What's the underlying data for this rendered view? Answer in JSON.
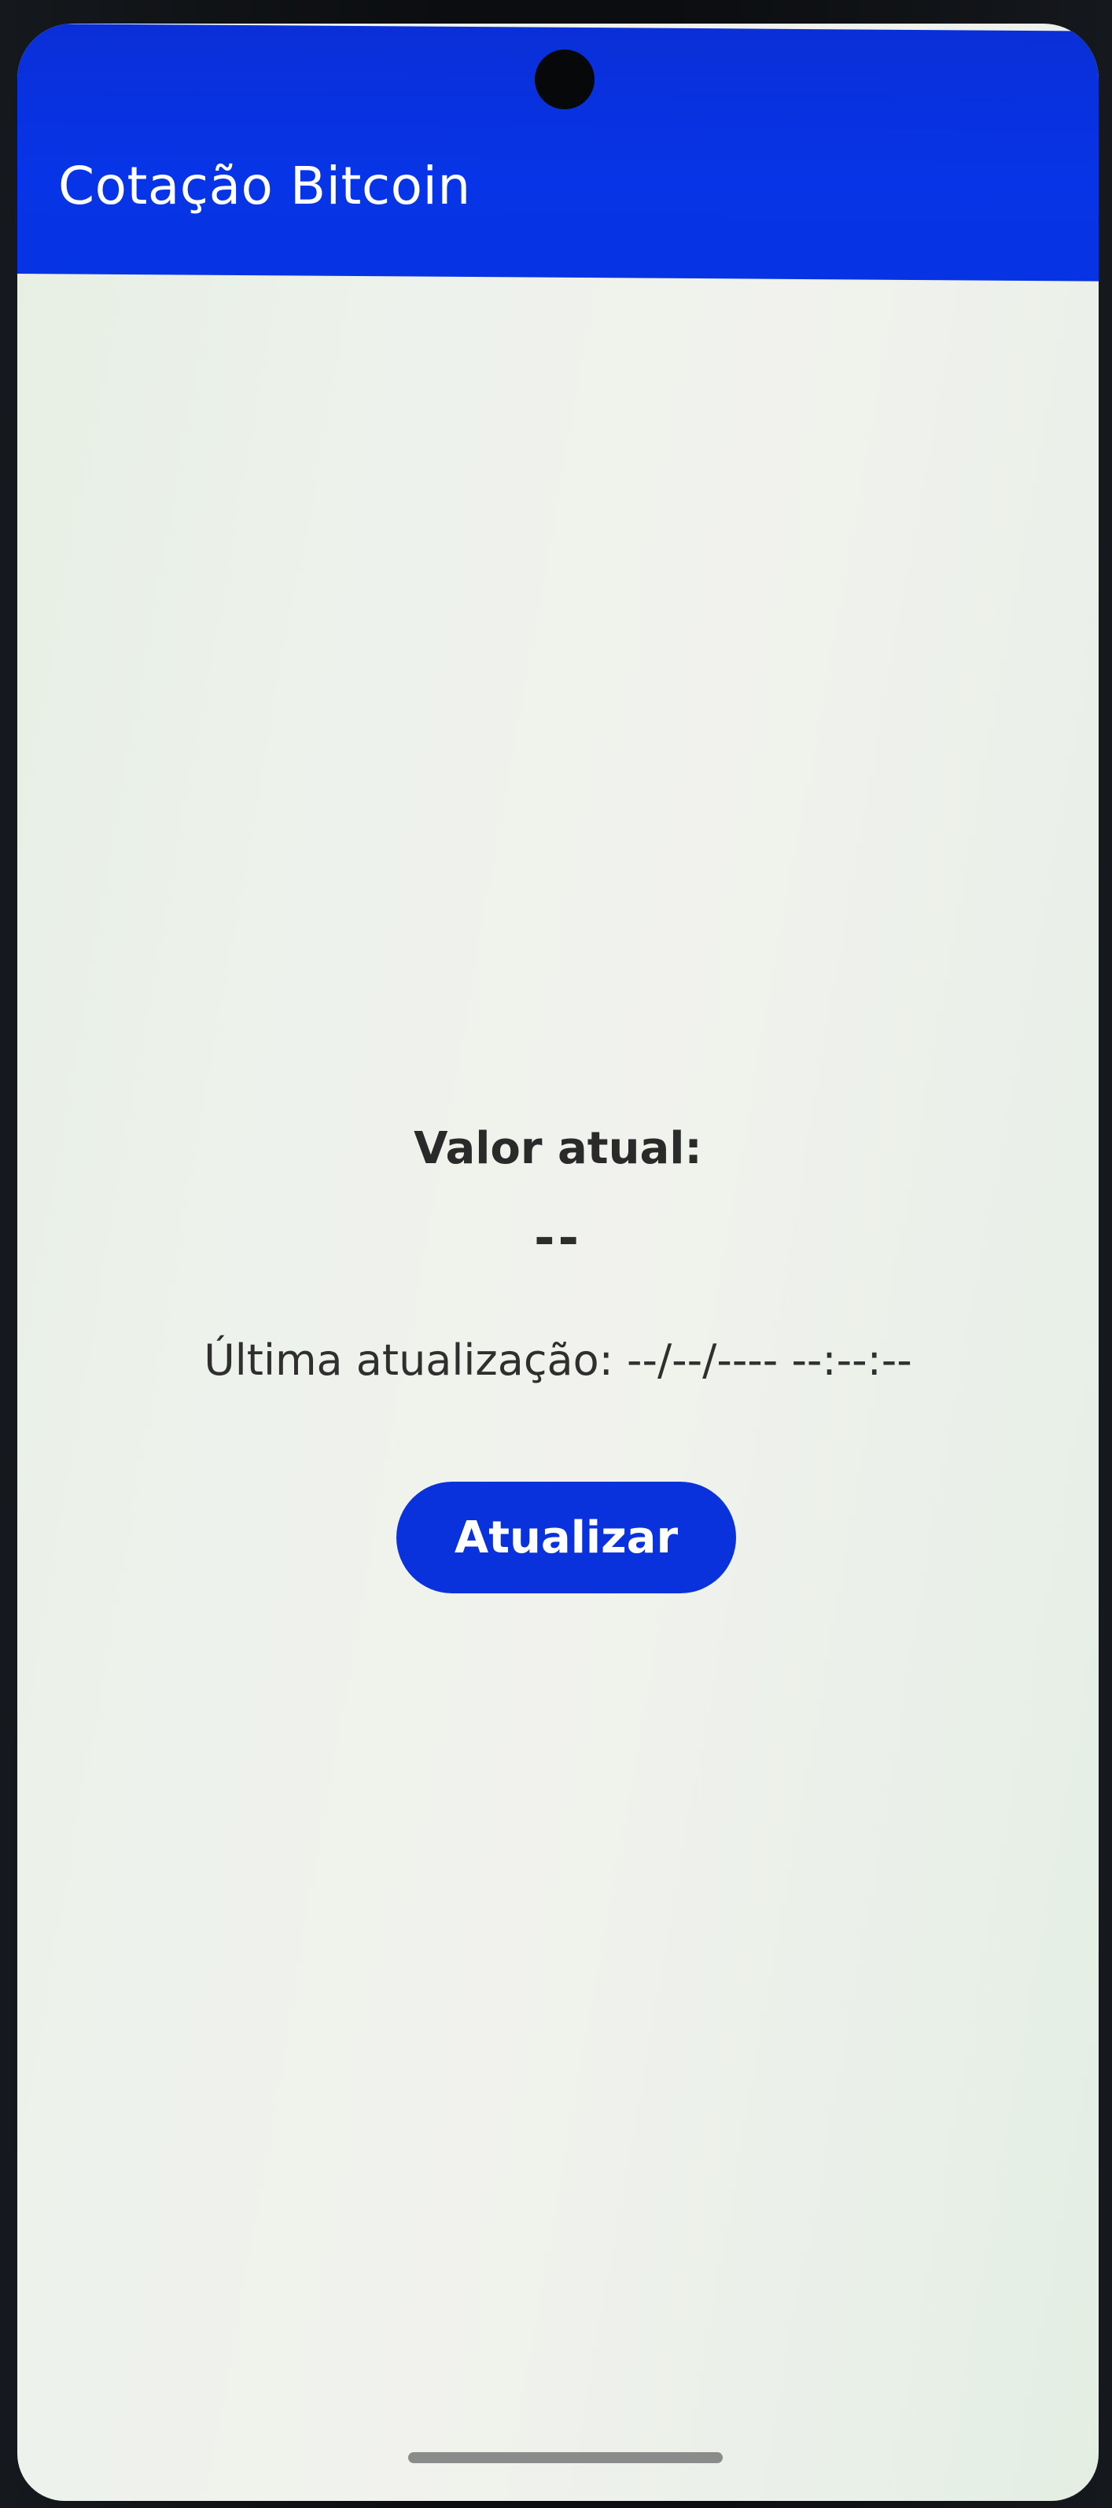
{
  "app_bar": {
    "title": "Cotação Bitcoin",
    "color": "#0734e6"
  },
  "main": {
    "value_label": "Valor atual:",
    "value": "--",
    "last_updated": "Última atualização: --/--/---- --:--:--",
    "refresh_button_label": "Atualizar",
    "button_color": "#0a32dc"
  }
}
